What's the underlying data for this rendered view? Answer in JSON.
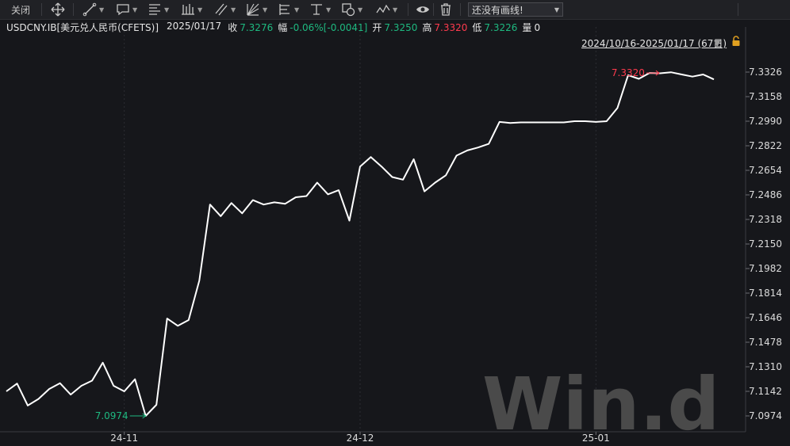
{
  "toolbar": {
    "close_label": "关闭",
    "drawing_placeholder": "还没有画线!",
    "icons": [
      "move-icon",
      "line-tool-icon",
      "callout-tool-icon",
      "text-tool-icon",
      "bar-tool-icon",
      "parallel-line-icon",
      "fan-tool-icon",
      "fib-tool-icon",
      "level-tool-icon",
      "shape-tool-icon",
      "wave-tool-icon",
      "eye-icon",
      "trash-icon"
    ]
  },
  "info": {
    "symbol": "USDCNY.IB[美元兑人民币(CFETS)]",
    "date": "2025/01/17",
    "close_label": "收",
    "close": "7.3276",
    "change_label": "幅",
    "change": "-0.06%[-0.0041]",
    "open_label": "开",
    "open": "7.3250",
    "high_label": "高",
    "high": "7.3320",
    "low_label": "低",
    "low": "7.3226",
    "volume_label": "量",
    "volume": "0"
  },
  "range_label": "2024/10/16-2025/01/17 (67日)",
  "watermark": "Win.d",
  "chart_data": {
    "type": "line",
    "title": "",
    "xlabel": "",
    "ylabel": "",
    "ylim": [
      7.0874,
      7.3426
    ],
    "y_ticks": [
      "7.3326",
      "7.3158",
      "7.2990",
      "7.2822",
      "7.2654",
      "7.2486",
      "7.2318",
      "7.2150",
      "7.1982",
      "7.1814",
      "7.1646",
      "7.1478",
      "7.1310",
      "7.1142",
      "7.0974"
    ],
    "x_ticks": [
      "24-11",
      "24-12",
      "25-01"
    ],
    "x_tick_index": [
      11,
      33,
      55
    ],
    "grid": true,
    "series": [
      {
        "color": "#ffffff",
        "values": [
          7.1142,
          7.1195,
          7.1045,
          7.109,
          7.1158,
          7.1198,
          7.112,
          7.118,
          7.1215,
          7.1338,
          7.118,
          7.1142,
          7.1225,
          7.0974,
          7.105,
          7.164,
          7.159,
          7.163,
          7.19,
          7.242,
          7.234,
          7.243,
          7.236,
          7.245,
          7.242,
          7.2435,
          7.2425,
          7.247,
          7.2478,
          7.257,
          7.249,
          7.2518,
          7.231,
          7.268,
          7.2745,
          7.268,
          7.2608,
          7.259,
          7.273,
          7.251,
          7.257,
          7.262,
          7.2755,
          7.279,
          7.281,
          7.2835,
          7.2985,
          7.2978,
          7.2982,
          7.2982,
          7.2982,
          7.2982,
          7.2982,
          7.299,
          7.299,
          7.2985,
          7.299,
          7.308,
          7.3305,
          7.328,
          7.332,
          7.3318,
          7.3325,
          7.331,
          7.3295,
          7.331,
          7.3276
        ]
      }
    ],
    "annotations": [
      {
        "text": "7.0974",
        "index": 13,
        "value": 7.0974,
        "color": "#1eb980",
        "side": "left"
      },
      {
        "text": "7.3320",
        "index": 60,
        "value": 7.332,
        "color": "#ff3b4e",
        "side": "right"
      }
    ]
  }
}
